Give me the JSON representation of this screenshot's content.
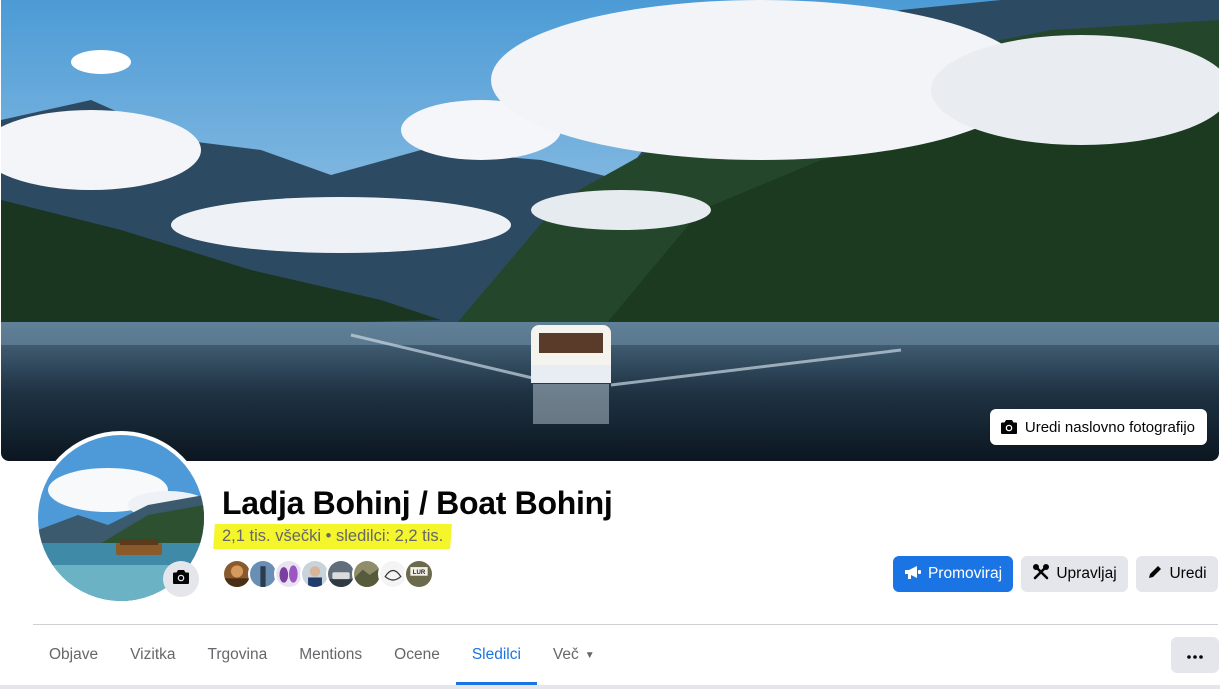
{
  "cover": {
    "edit_label": "Uredi naslovno fotografijo",
    "icon": "camera-icon"
  },
  "profile": {
    "avatar_icon": "camera-icon",
    "name": "Ladja Bohinj / Boat Bohinj",
    "stats": "2,1 tis. všečki • sledilci: 2,2 tis.",
    "follower_avatars_count": 8
  },
  "actions": {
    "promote": {
      "label": "Promoviraj",
      "icon": "megaphone-icon"
    },
    "manage": {
      "label": "Upravljaj",
      "icon": "tools-icon"
    },
    "edit": {
      "label": "Uredi",
      "icon": "pencil-icon"
    }
  },
  "tabs": [
    {
      "label": "Objave",
      "active": false
    },
    {
      "label": "Vizitka",
      "active": false
    },
    {
      "label": "Trgovina",
      "active": false
    },
    {
      "label": "Mentions",
      "active": false
    },
    {
      "label": "Ocene",
      "active": false
    },
    {
      "label": "Sledilci",
      "active": true
    },
    {
      "label": "Več",
      "active": false,
      "dropdown": true
    }
  ],
  "more_menu": {
    "icon": "more-horizontal-icon"
  },
  "colors": {
    "accent": "#1b74e4",
    "highlight": "#f5f52c",
    "button_grey": "#e4e6eb",
    "secondary_text": "#65676b"
  }
}
